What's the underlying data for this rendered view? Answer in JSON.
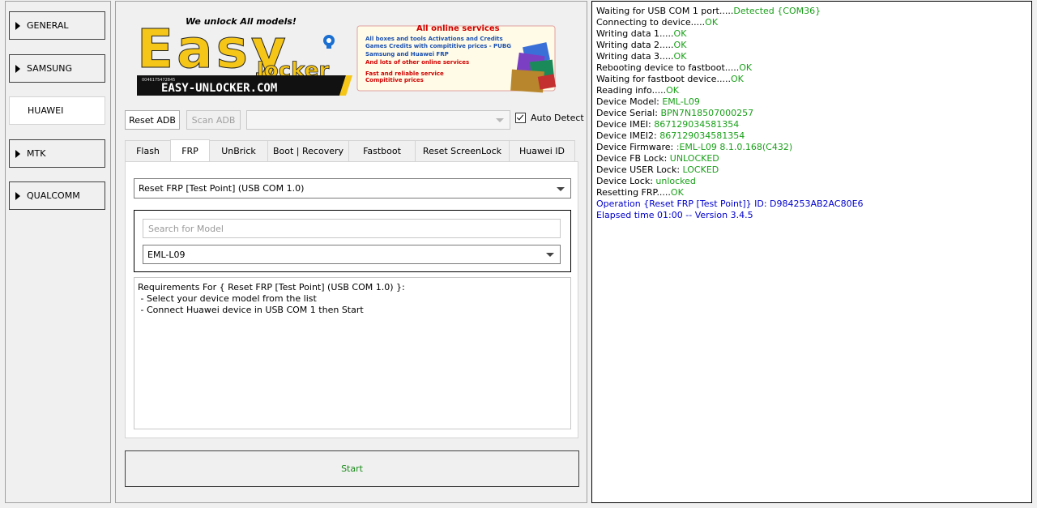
{
  "nav": {
    "items": [
      {
        "label": "GENERAL",
        "active": false
      },
      {
        "label": "SAMSUNG",
        "active": false
      },
      {
        "label": "HUAWEI",
        "active": true
      },
      {
        "label": "MTK",
        "active": false
      },
      {
        "label": "QUALCOMM",
        "active": false
      }
    ]
  },
  "banner": {
    "tagline": "We unlock All models!",
    "logo_text_main": "Easy",
    "logo_text_sub": "locker",
    "website": "EASY-UNLOCKER.COM",
    "small_code": "0046175472845",
    "services_title": "All online services",
    "services_lines": [
      "All boxes and tools Activations and Credits",
      "Games Credits with compititive prices - PUBG",
      "Samsung and Huawei FRP",
      "And lots of other online services",
      "Fast and reliable service",
      "Compititive prices"
    ]
  },
  "toolbar": {
    "reset_adb_label": "Reset ADB",
    "scan_adb_label": "Scan ADB",
    "port_value": "",
    "auto_detect_label": "Auto Detect",
    "auto_detect_checked": true
  },
  "tabs": [
    {
      "label": "Flash",
      "active": false
    },
    {
      "label": "FRP",
      "active": true
    },
    {
      "label": "UnBrick",
      "active": false
    },
    {
      "label": "Boot | Recovery",
      "active": false
    },
    {
      "label": "Fastboot",
      "active": false
    },
    {
      "label": "Reset ScreenLock",
      "active": false
    },
    {
      "label": "Huawei ID",
      "active": false
    }
  ],
  "frp": {
    "operation_value": "Reset FRP [Test Point] (USB COM 1.0)",
    "search_placeholder": "Search for Model",
    "model_value": "EML-L09",
    "requirements": "Requirements For { Reset FRP [Test Point] (USB COM 1.0) }:\n - Select your device model from the list\n - Connect Huawei device in USB COM 1 then Start"
  },
  "start_label": "Start",
  "colors": {
    "ok": "#19a019",
    "info": "#0000cc"
  },
  "log": [
    {
      "text": "Waiting for USB COM 1 port.....",
      "status": "Detected {COM36}",
      "status_type": "ok"
    },
    {
      "text": "Connecting to device.....",
      "status": "OK",
      "status_type": "ok"
    },
    {
      "text": "Writing data 1.....",
      "status": "OK",
      "status_type": "ok"
    },
    {
      "text": "Writing data 2.....",
      "status": "OK",
      "status_type": "ok"
    },
    {
      "text": "Writing data 3.....",
      "status": "OK",
      "status_type": "ok"
    },
    {
      "text": "Rebooting device to fastboot.....",
      "status": "OK",
      "status_type": "ok"
    },
    {
      "text": "Waiting for fastboot device.....",
      "status": "OK",
      "status_type": "ok"
    },
    {
      "text": "Reading info.....",
      "status": "OK",
      "status_type": "ok"
    },
    {
      "text": "Device Model: ",
      "status": "EML-L09",
      "status_type": "ok"
    },
    {
      "text": "Device Serial: ",
      "status": "BPN7N18507000257",
      "status_type": "ok"
    },
    {
      "text": "Device IMEI: ",
      "status": "867129034581354",
      "status_type": "ok"
    },
    {
      "text": "Device IMEI2: ",
      "status": "867129034581354",
      "status_type": "ok"
    },
    {
      "text": "Device Firmware: ",
      "status": ":EML-L09 8.1.0.168(C432)",
      "status_type": "ok"
    },
    {
      "text": "Device FB Lock: ",
      "status": "UNLOCKED",
      "status_type": "ok"
    },
    {
      "text": "Device USER Lock: ",
      "status": "LOCKED",
      "status_type": "ok"
    },
    {
      "text": "Device Lock: ",
      "status": "unlocked",
      "status_type": "ok"
    },
    {
      "text": "Resetting FRP.....",
      "status": "OK",
      "status_type": "ok"
    },
    {
      "text": "Operation {Reset FRP [Test Point]} ID: D984253AB2AC80E6",
      "status": "",
      "status_type": "info"
    },
    {
      "text": "Elapsed time 01:00 -- Version 3.4.5",
      "status": "",
      "status_type": "info"
    }
  ]
}
